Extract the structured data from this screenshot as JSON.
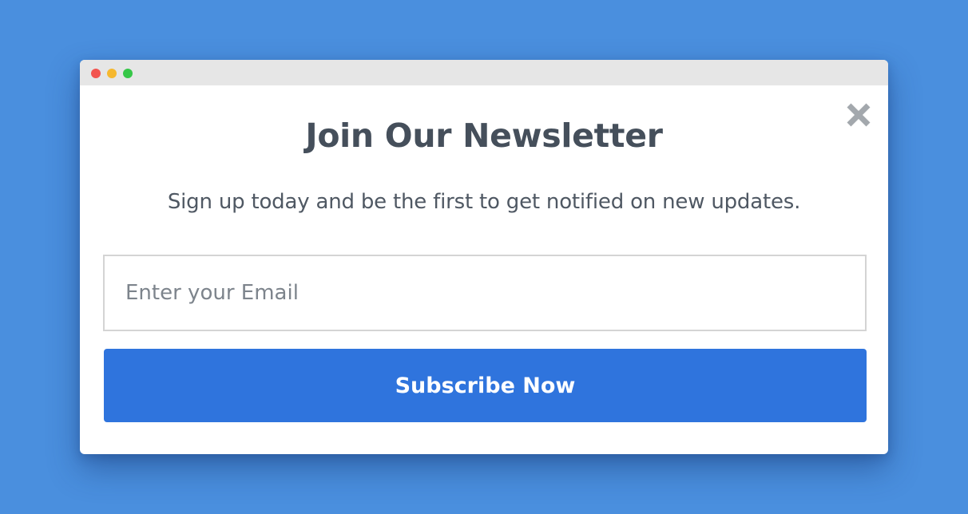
{
  "popup": {
    "title": "Join Our Newsletter",
    "subtitle": "Sign up today and be the first to get notified on new updates.",
    "email_placeholder": "Enter your Email",
    "email_value": "",
    "subscribe_label": "Subscribe Now",
    "close_icon": "close-icon"
  },
  "window": {
    "controls": [
      "close",
      "minimize",
      "maximize"
    ]
  },
  "colors": {
    "background": "#4a8fde",
    "button": "#2f74dd",
    "title_text": "#454f5b",
    "close_icon": "#a3a8ad"
  }
}
